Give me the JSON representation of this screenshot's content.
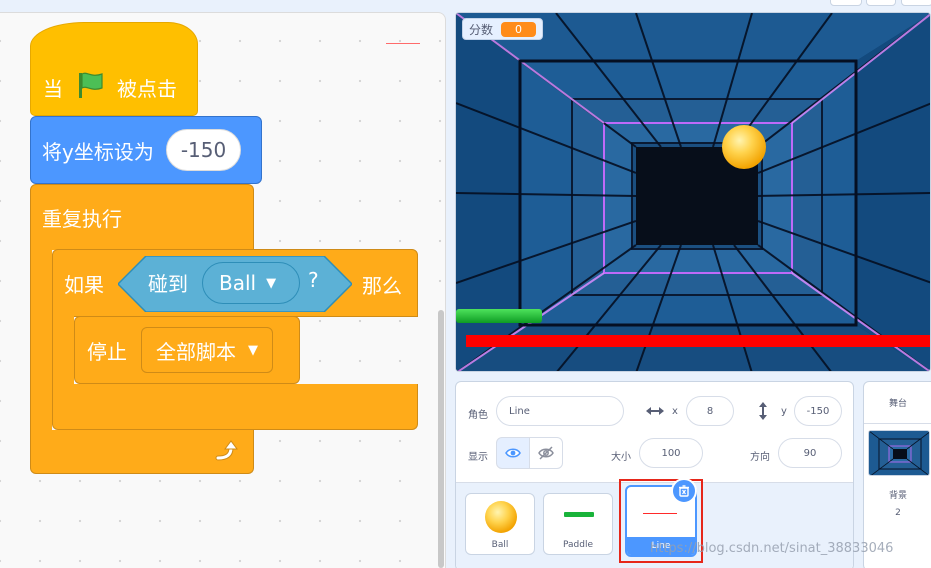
{
  "code": {
    "hat": {
      "prefix": "当",
      "suffix": "被点击",
      "icon": "green-flag-icon"
    },
    "set_y": {
      "label": "将y坐标设为",
      "value": "-150"
    },
    "repeat": {
      "label": "重复执行",
      "loop_icon": "loop-arrow-icon"
    },
    "if_block": {
      "if_label": "如果",
      "then_label": "那么"
    },
    "touching": {
      "label": "碰到",
      "target": "Ball",
      "question": "?"
    },
    "stop": {
      "label": "停止",
      "option": "全部脚本"
    }
  },
  "stage": {
    "score_monitor": {
      "label": "分数",
      "value": "0",
      "value_color": "#ff8c1a"
    },
    "backdrop_colors": {
      "tunnel": "#0a2a52",
      "neon": "#c86bff",
      "center": "#070e1a"
    },
    "sprites_on_stage": [
      "Ball",
      "Paddle",
      "Line"
    ]
  },
  "sprite_info": {
    "sprite_label": "角色",
    "sprite_name": "Line",
    "x_label": "x",
    "x_value": "8",
    "y_label": "y",
    "y_value": "-150",
    "show_label": "显示",
    "size_label": "大小",
    "size_value": "100",
    "direction_label": "方向",
    "direction_value": "90"
  },
  "sprites": [
    {
      "name": "Ball"
    },
    {
      "name": "Paddle"
    },
    {
      "name": "Line",
      "selected": true
    }
  ],
  "stage_pane": {
    "title": "舞台",
    "backdrop_label": "背景",
    "backdrop_count": "2"
  },
  "watermark": "https://blog.csdn.net/sinat_38833046",
  "colors": {
    "motion": "#4c97ff",
    "events": "#ffbf00",
    "control": "#ffab19",
    "sensing": "#5cb1d6",
    "selection": "#e6271a"
  }
}
